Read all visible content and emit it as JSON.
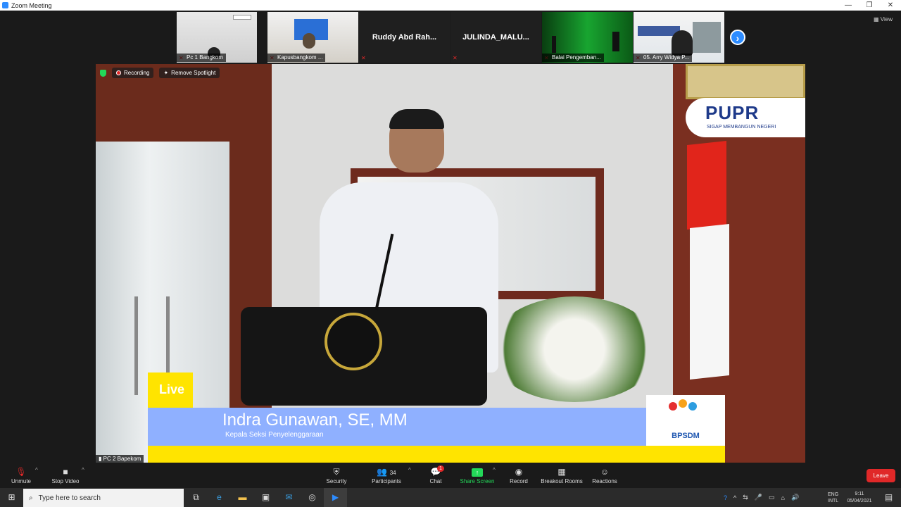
{
  "window": {
    "title": "Zoom Meeting",
    "minimize": "—",
    "restore": "❐",
    "close": "✕"
  },
  "view_button": {
    "label": "View"
  },
  "thumbnails": [
    {
      "name": "Pc 1 Bangkom",
      "big_name": ""
    },
    {
      "name": "Kapusbangkom ...",
      "big_name": ""
    },
    {
      "name": "",
      "big_name": "Ruddy Abd Rah..."
    },
    {
      "name": "",
      "big_name": "JULINDA_MALU..."
    },
    {
      "name": "Balai Pengemban...",
      "big_name": ""
    },
    {
      "name": "05. Arry Widya P...",
      "big_name": ""
    }
  ],
  "spotlight": {
    "recording_label": "Recording",
    "remove_spotlight_label": "Remove Spotlight",
    "pc_label": "PC 2 Bapekom",
    "live_label": "Live",
    "speaker_name": "Indra Gunawan, SE, MM",
    "speaker_role": "Kepala Seksi Penyelenggaraan",
    "logo_pupr": "PUPR",
    "logo_pupr_tagline": "SIGAP MEMBANGUN NEGERI",
    "logo_bpsdm": "BPSDM",
    "colors": {
      "accent_blue": "#8fb0ff",
      "live_yellow": "#ffe400",
      "pupr_blue": "#1e3a8a"
    }
  },
  "toolbar": {
    "unmute": "Unmute",
    "stop_video": "Stop Video",
    "security": "Security",
    "participants": "Participants",
    "participants_count": "34",
    "chat": "Chat",
    "chat_badge": "1",
    "share_screen": "Share Screen",
    "record": "Record",
    "breakout_rooms": "Breakout Rooms",
    "reactions": "Reactions",
    "leave": "Leave"
  },
  "taskbar": {
    "search_placeholder": "Type here to search",
    "lang_top": "ENG",
    "lang_bottom": "INTL",
    "time": "9:11",
    "date": "05/04/2021"
  }
}
